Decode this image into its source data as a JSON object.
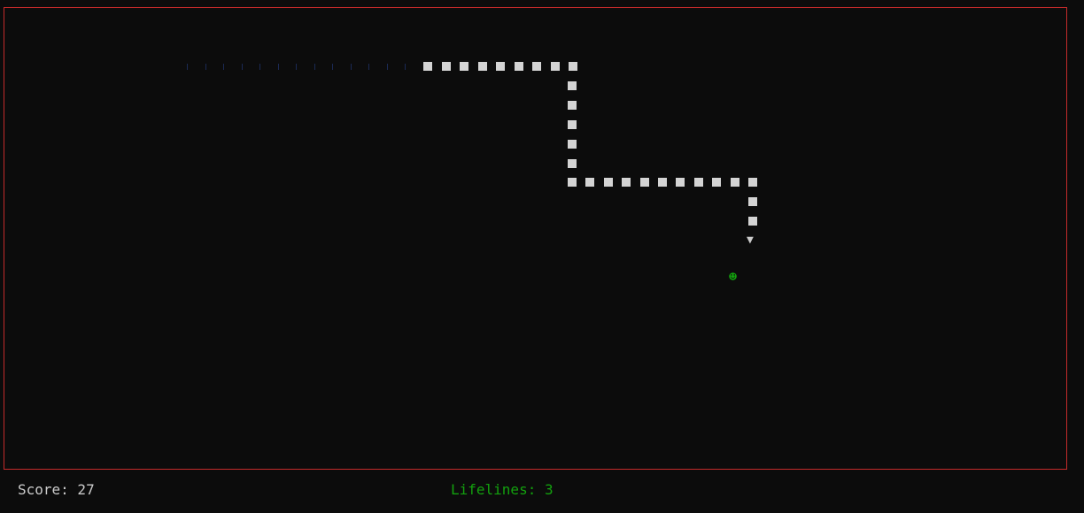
{
  "colors": {
    "background": "#0c0c0c",
    "border": "#c42b2b",
    "snake_body": "#d4d4d4",
    "snake_head": "#cccccc",
    "trail": "#1b2a55",
    "food": "#13a10e",
    "score_text": "#cccccc",
    "lifelines_text": "#13a10e"
  },
  "snake": {
    "head_glyph": "▼",
    "direction": "down",
    "body_segments": 26,
    "trail_marks": 13
  },
  "food": {
    "glyph": "☻",
    "icon": "food-icon"
  },
  "status": {
    "score_label": "Score: 27",
    "lifelines_label": "Lifelines: 3"
  }
}
